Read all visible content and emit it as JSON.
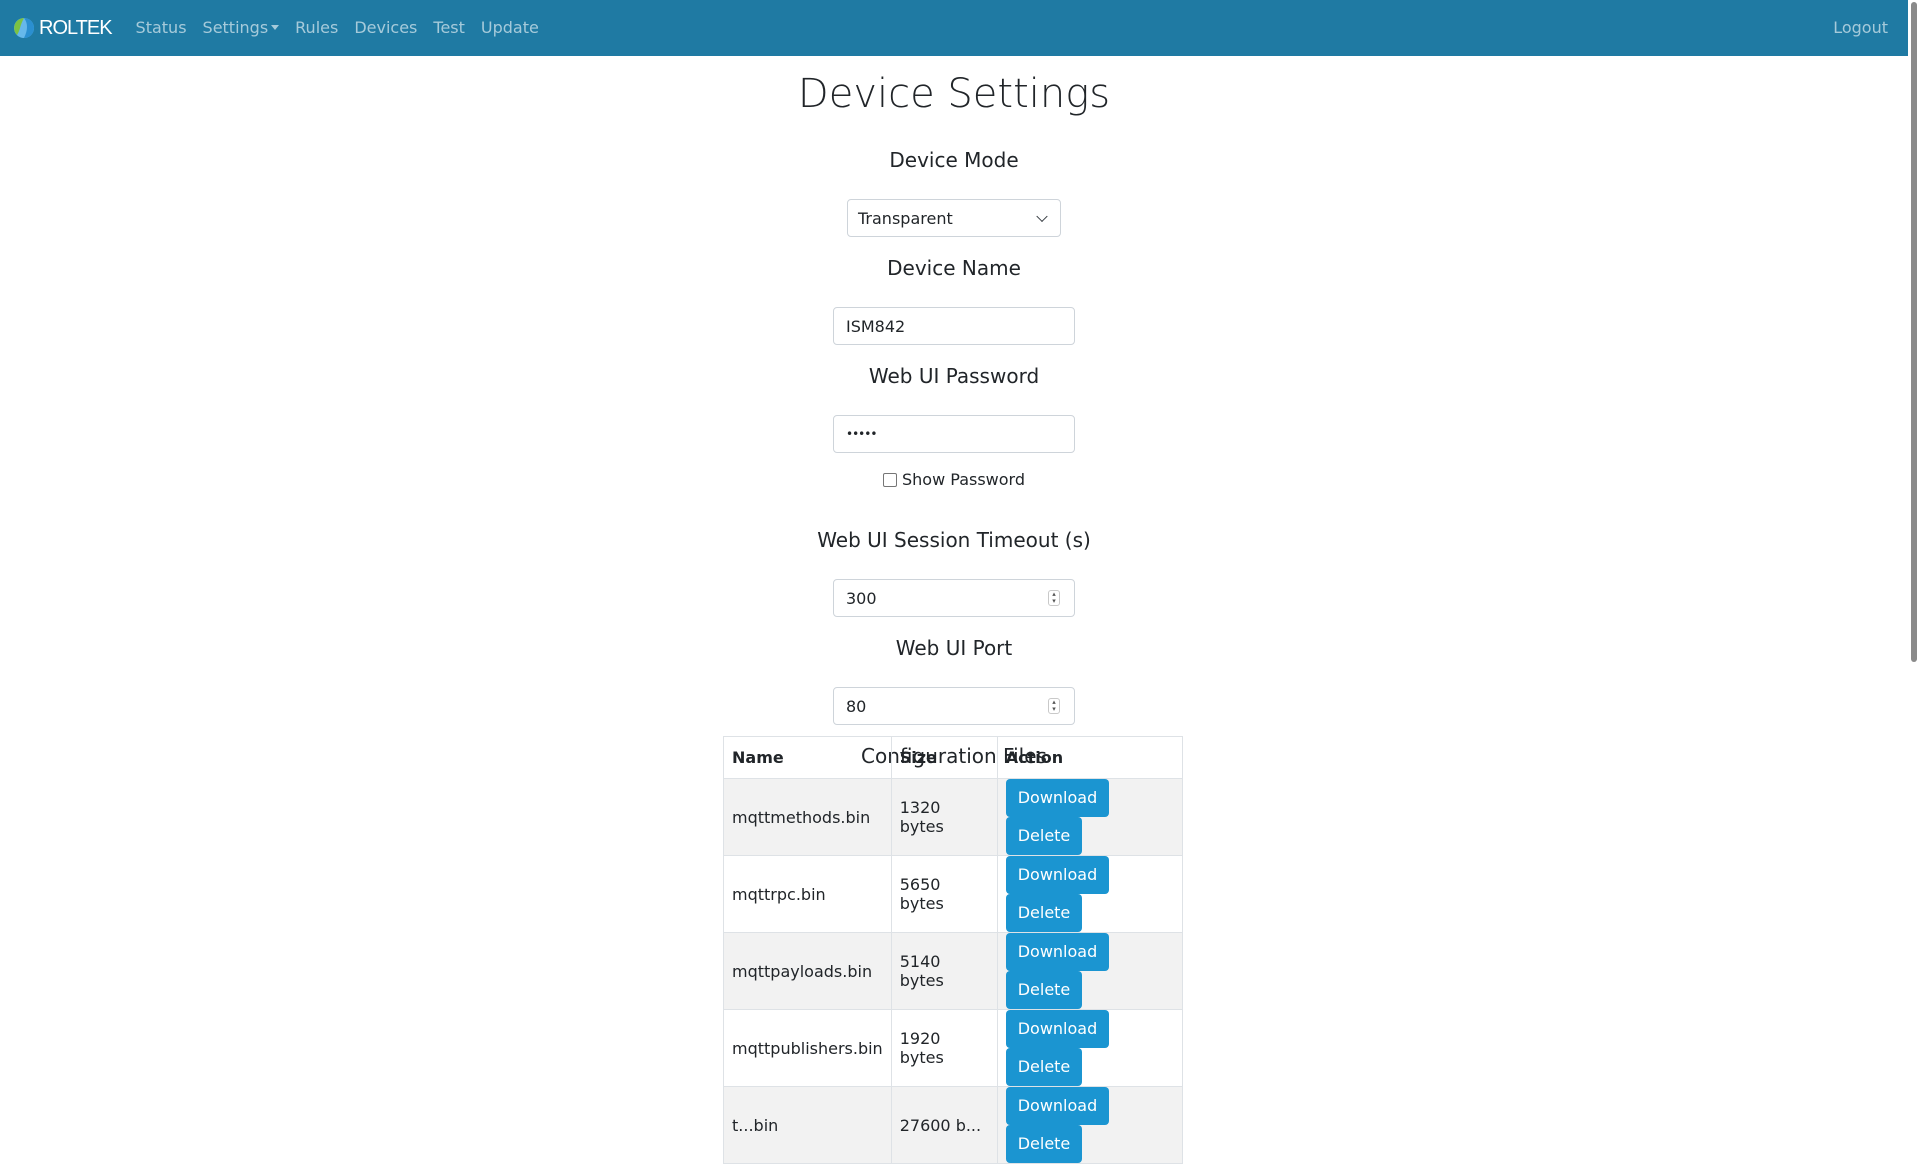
{
  "navbar": {
    "brand": "ROLTEK",
    "links": [
      "Status",
      "Settings",
      "Rules",
      "Devices",
      "Test",
      "Update"
    ],
    "logout": "Logout",
    "color": "#1f7aa3"
  },
  "page": {
    "title": "Device Settings"
  },
  "device_mode": {
    "label": "Device Mode",
    "value": "Transparent"
  },
  "device_name": {
    "label": "Device Name",
    "value": "ISM842"
  },
  "password": {
    "label": "Web UI Password",
    "value": "•••••",
    "show_label": "Show Password",
    "show_checked": false
  },
  "timeout": {
    "label": "Web UI Session Timeout (s)",
    "value": "300"
  },
  "port": {
    "label": "Web UI Port",
    "value": "80"
  },
  "config_files": {
    "label": "Configuration Files",
    "headers": [
      "Name",
      "Size",
      "Action"
    ],
    "download_label": "Download",
    "delete_label": "Delete",
    "button_color": "#1b95d1",
    "rows": [
      {
        "name": "mqttmethods.bin",
        "size": "1320 bytes"
      },
      {
        "name": "mqttrpc.bin",
        "size": "5650 bytes"
      },
      {
        "name": "mqttpayloads.bin",
        "size": "5140 bytes"
      },
      {
        "name": "mqttpublishers.bin",
        "size": "1920 bytes"
      },
      {
        "name": "t...bin",
        "size": "27600 b..."
      }
    ]
  }
}
